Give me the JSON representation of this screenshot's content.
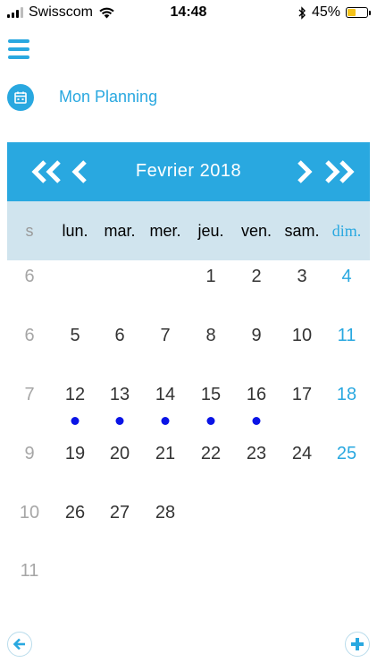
{
  "status_bar": {
    "carrier": "Swisscom",
    "time": "14:48",
    "battery_percent": "45%",
    "battery_level": 0.45,
    "battery_color": "#f4c21a"
  },
  "header": {
    "title": "Mon Planning",
    "menu_icon": "hamburger-menu-icon",
    "title_icon": "calendar-icon"
  },
  "calendar": {
    "month_label": "Fevrier  2018",
    "nav_icons": [
      "double-chevron-left-icon",
      "chevron-left-icon",
      "chevron-right-icon",
      "double-chevron-right-icon"
    ],
    "weekday_header": [
      "s",
      "lun.",
      "mar.",
      "mer.",
      "jeu.",
      "ven.",
      "sam.",
      "dim."
    ],
    "weeks": [
      {
        "week": "6",
        "days": [
          "",
          "",
          "",
          "1",
          "2",
          "3",
          "4"
        ]
      },
      {
        "week": "6",
        "days": [
          "5",
          "6",
          "7",
          "8",
          "9",
          "10",
          "11"
        ]
      },
      {
        "week": "7",
        "days": [
          "12",
          "13",
          "14",
          "15",
          "16",
          "17",
          "18"
        ]
      },
      {
        "week": "9",
        "days": [
          "19",
          "20",
          "21",
          "22",
          "23",
          "24",
          "25"
        ]
      },
      {
        "week": "10",
        "days": [
          "26",
          "27",
          "28",
          "",
          "",
          "",
          ""
        ]
      },
      {
        "week": "11",
        "days": [
          "",
          "",
          "",
          "",
          "",
          "",
          ""
        ]
      }
    ],
    "days_with_events": [
      "12",
      "13",
      "14",
      "15",
      "16"
    ]
  },
  "colors": {
    "accent": "#29a8e0",
    "weekday_bg": "#d0e4ee",
    "event_dot": "#0a14e6"
  },
  "footer": {
    "back_icon": "arrow-left-icon",
    "add_icon": "plus-icon"
  }
}
